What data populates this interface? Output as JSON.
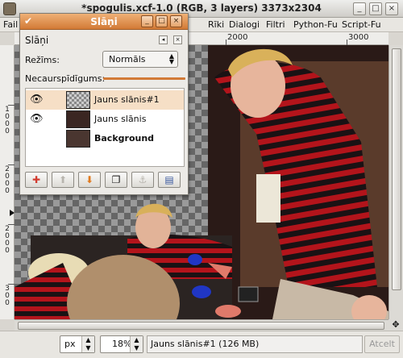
{
  "window": {
    "title": "*spogulis.xcf-1.0 (RGB, 3 layers) 3373x2304",
    "buttons": {
      "minimize": "_",
      "maximize": "□",
      "close": "×"
    }
  },
  "menubar": {
    "items": [
      "Fail",
      "Rīki",
      "Dialogi",
      "Filtri",
      "Python-Fu",
      "Script-Fu"
    ]
  },
  "ruler": {
    "h_labels": [
      "2000",
      "3000"
    ],
    "v_labels": [
      "1000",
      "2000"
    ]
  },
  "statusbar": {
    "unit": "px",
    "zoom": "18%",
    "message": "Jauns slānis#1 (126 MB)",
    "cancel_label": "Atcelt"
  },
  "layers_dialog": {
    "title": "Slāņi",
    "tab_label": "Slāņi",
    "mode_label": "Režīms:",
    "mode_value": "Normāls",
    "opacity_label": "Necaurspīdīgums:",
    "opacity_value": 100,
    "layers": [
      {
        "name": "Jauns slānis#1",
        "visible": true,
        "selected": true
      },
      {
        "name": "Jauns slānis",
        "visible": true,
        "selected": false
      },
      {
        "name": "Background",
        "visible": false,
        "selected": false
      }
    ],
    "buttons": [
      "new-layer",
      "raise-layer",
      "lower-layer",
      "duplicate-layer",
      "anchor-layer",
      "delete-layer"
    ]
  },
  "colors": {
    "dock_title": "#d27a36",
    "selected_layer": "#f6dfc6",
    "checker_dark": "#666666",
    "checker_light": "#9a9a9a"
  }
}
